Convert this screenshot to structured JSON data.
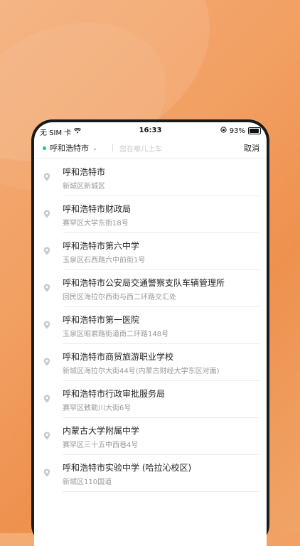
{
  "status": {
    "carrier": "无 SIM 卡",
    "time": "16:33",
    "battery_pct": "93%"
  },
  "search": {
    "city": "呼和浩特市",
    "placeholder": "您在哪儿上车",
    "cancel": "取消"
  },
  "results": [
    {
      "name": "呼和浩特市",
      "addr": "新城区新城区"
    },
    {
      "name": "呼和浩特市财政局",
      "addr": "赛罕区大学东街18号"
    },
    {
      "name": "呼和浩特市第六中学",
      "addr": "玉泉区石西路六中前街1号"
    },
    {
      "name": "呼和浩特市公安局交通警察支队车辆管理所",
      "addr": "回民区海拉尔西街与西二环路交汇处"
    },
    {
      "name": "呼和浩特市第一医院",
      "addr": "玉泉区昭君路街道南二环路148号"
    },
    {
      "name": "呼和浩特市商贸旅游职业学校",
      "addr": "新城区海拉尔大街44号(内蒙古财经大学东区对面)"
    },
    {
      "name": "呼和浩特市行政审批服务局",
      "addr": "赛罕区敕勒川大街6号"
    },
    {
      "name": "内蒙古大学附属中学",
      "addr": "赛罕区三十五中西巷4号"
    },
    {
      "name": "呼和浩特市实验中学 (哈拉沁校区)",
      "addr": "新城区110国道"
    }
  ]
}
